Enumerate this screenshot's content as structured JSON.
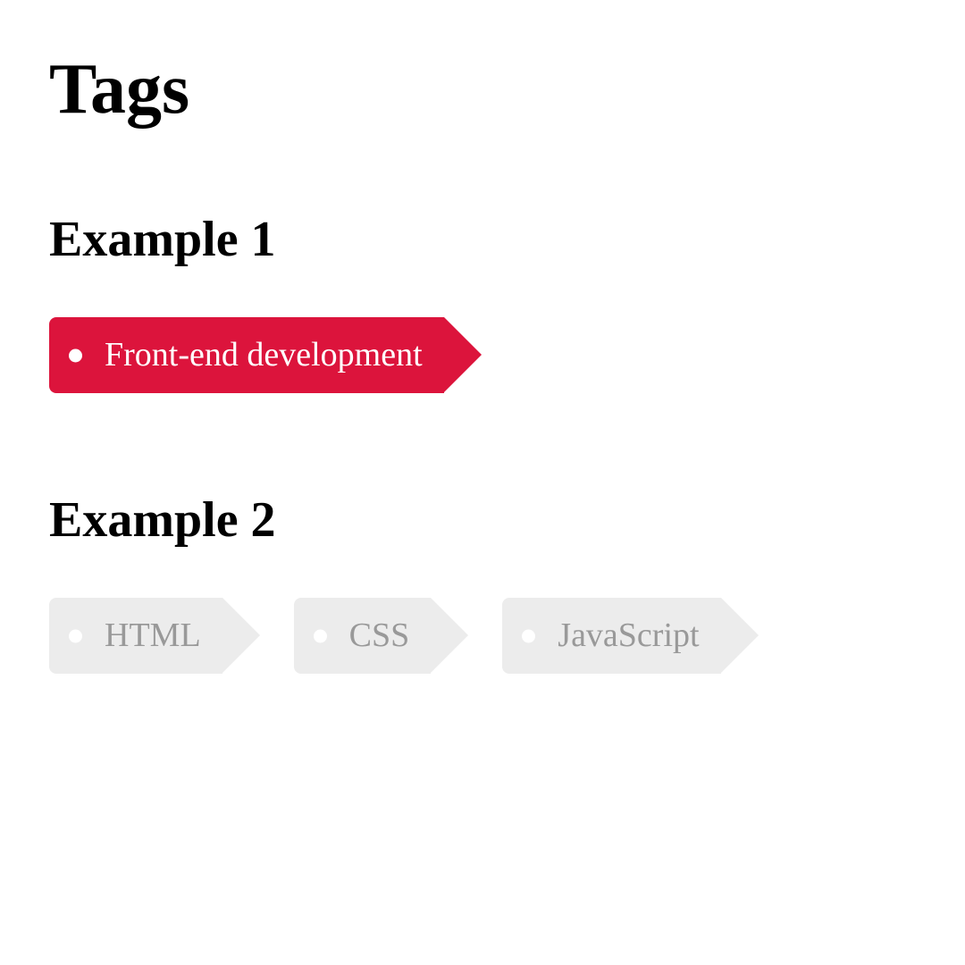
{
  "page_title": "Tags",
  "sections": [
    {
      "heading": "Example 1",
      "tags": [
        {
          "label": "Front-end development",
          "variant": "active"
        }
      ]
    },
    {
      "heading": "Example 2",
      "tags": [
        {
          "label": "HTML",
          "variant": "default"
        },
        {
          "label": "CSS",
          "variant": "default"
        },
        {
          "label": "JavaScript",
          "variant": "default"
        }
      ]
    }
  ],
  "colors": {
    "active_bg": "#dc143c",
    "default_bg": "#ececec",
    "default_text": "#999"
  }
}
